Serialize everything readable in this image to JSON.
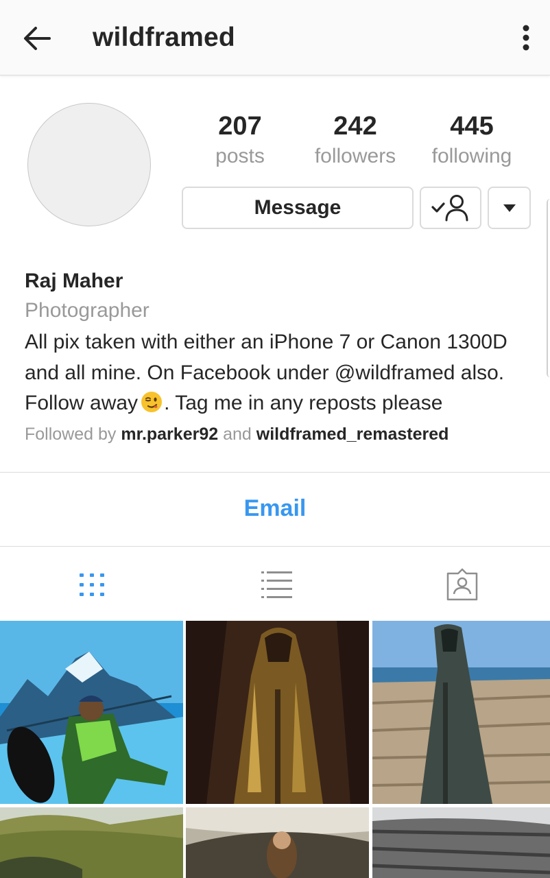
{
  "header": {
    "username": "wildframed",
    "back_icon": "arrow-back-icon",
    "more_icon": "more-vertical-icon"
  },
  "profile": {
    "stats": [
      {
        "value": "207",
        "label": "posts"
      },
      {
        "value": "242",
        "label": "followers"
      },
      {
        "value": "445",
        "label": "following"
      }
    ],
    "buttons": {
      "message_label": "Message",
      "following_icon": "person-check-icon",
      "dropdown_icon": "caret-down-icon"
    }
  },
  "bio": {
    "name": "Raj Maher",
    "category": "Photographer",
    "line1": "All pix taken with either an iPhone 7 or Canon 1300D",
    "line2": "and all mine. On Facebook under @wildframed also.",
    "line3_pre": "Follow away",
    "line3_emoji": "winking-face-emoji",
    "line3_post": ". Tag me in any reposts please",
    "followed_by_prefix": "Followed by",
    "followed_by_user1": "mr.parker92",
    "followed_by_and": "and",
    "followed_by_user2": "wildframed_remastered"
  },
  "contact": {
    "email_label": "Email"
  },
  "tabs": [
    {
      "name": "grid",
      "icon": "grid-icon",
      "active": true
    },
    {
      "name": "list",
      "icon": "list-icon",
      "active": false
    },
    {
      "name": "tagged",
      "icon": "tagged-person-icon",
      "active": false
    }
  ],
  "photos": [
    {
      "subject": "snowboarder-mountain"
    },
    {
      "subject": "cloaked-statue-dark"
    },
    {
      "subject": "cloaked-statue-coast"
    },
    {
      "subject": "green-hills"
    },
    {
      "subject": "person-rocks"
    },
    {
      "subject": "rocky-landscape"
    }
  ],
  "colors": {
    "accent_blue": "#3897f0",
    "text_primary": "#262626",
    "text_secondary": "#999999",
    "border": "#dbdbdb"
  }
}
